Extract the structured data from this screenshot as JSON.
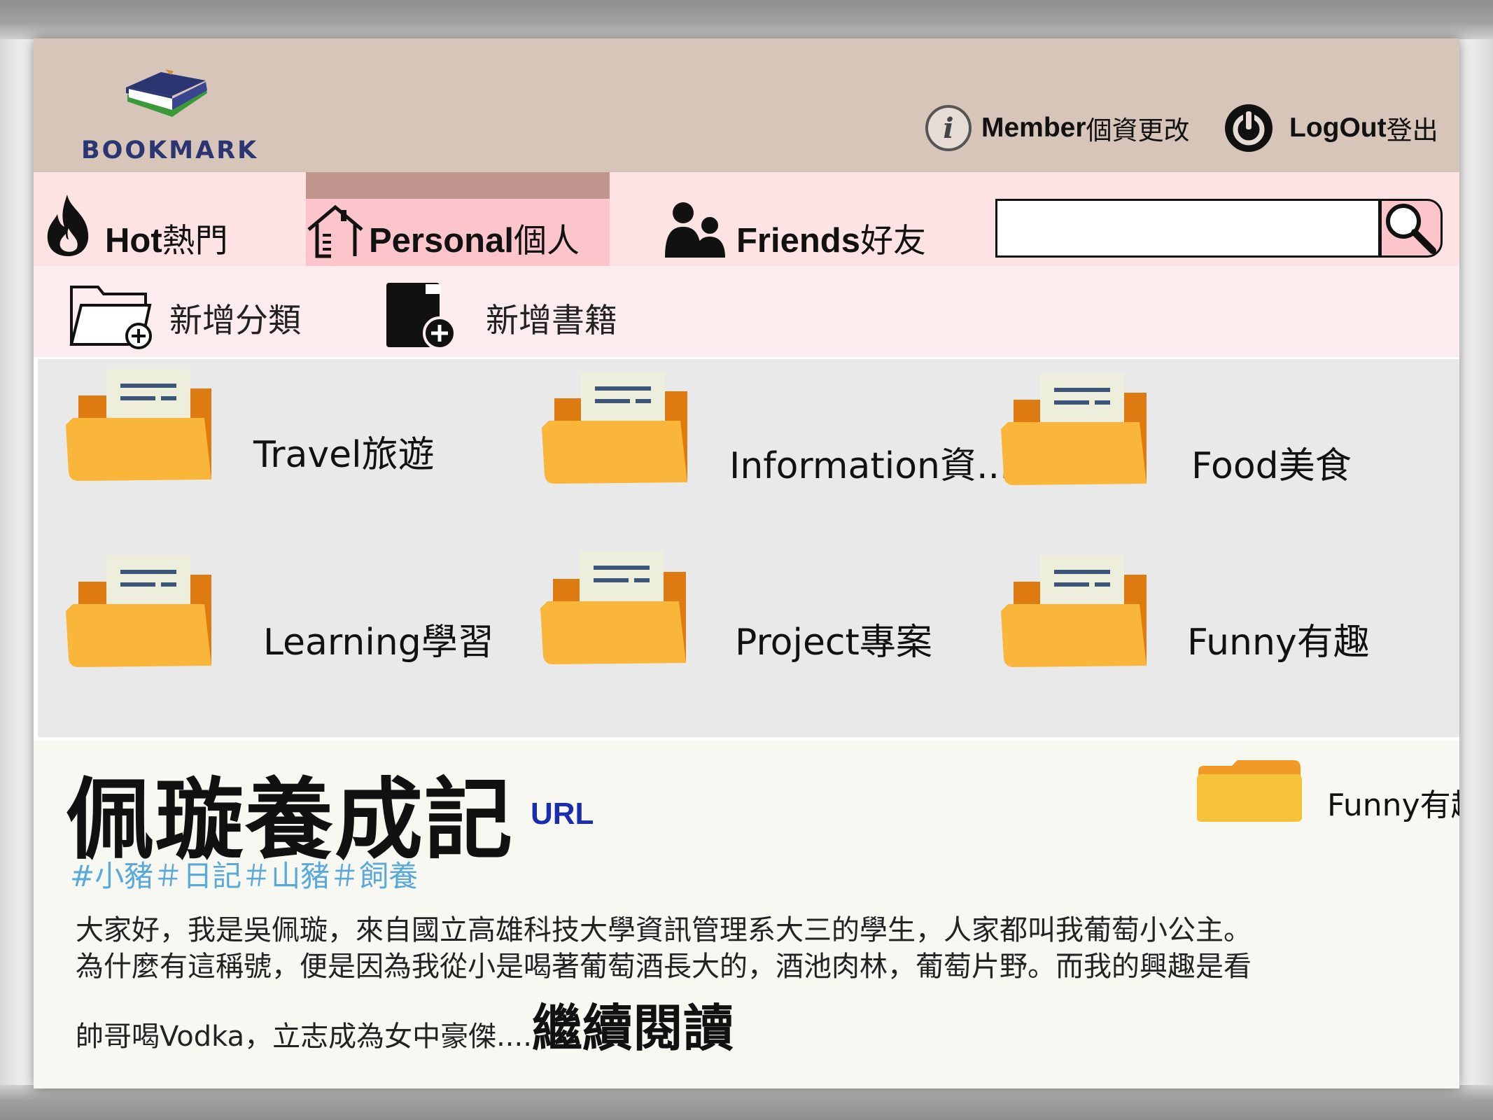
{
  "header": {
    "logo_text": "BOOKMARK",
    "member_bold": "Member",
    "member_cjk": "個資更改",
    "logout_bold": "LogOut",
    "logout_cjk": "登出"
  },
  "nav": {
    "tabs": [
      {
        "bold": "Hot",
        "cjk": "熱門",
        "icon": "flame-icon"
      },
      {
        "bold": "Personal",
        "cjk": "個人",
        "icon": "house-icon",
        "active": true
      },
      {
        "bold": "Friends",
        "cjk": "好友",
        "icon": "people-icon"
      }
    ],
    "search_value": ""
  },
  "actions": {
    "add_category": "新增分類",
    "add_book": "新增書籍"
  },
  "folders": [
    {
      "name": "Travel旅遊"
    },
    {
      "name": "Information資..."
    },
    {
      "name": "Food美食"
    },
    {
      "name": "Learning學習"
    },
    {
      "name": "Project專案"
    },
    {
      "name": "Funny有趣"
    }
  ],
  "article": {
    "title": "佩璇養成記",
    "url_label": "URL",
    "tags": "#小豬＃日記＃山豬＃飼養",
    "folder": "Funny有趣",
    "line1": "大家好，我是吳佩璇，來自國立高雄科技大學資訊管理系大三的學生，人家都叫我葡萄小公主。",
    "line2": "為什麼有這稱號，便是因為我從小是喝著葡萄酒長大的，酒池肉林，葡萄片野。而我的興趣是看",
    "line3": "帥哥喝Vodka，立志成為女中豪傑....",
    "read_more": "繼續閱讀"
  },
  "colors": {
    "header_bg": "#d8c5ba",
    "nav_bg": "#fde3e4",
    "active_tab": "#fbc5cb",
    "folder": "#fab63a",
    "url": "#1a2db0",
    "tags": "#5aa9d9"
  }
}
